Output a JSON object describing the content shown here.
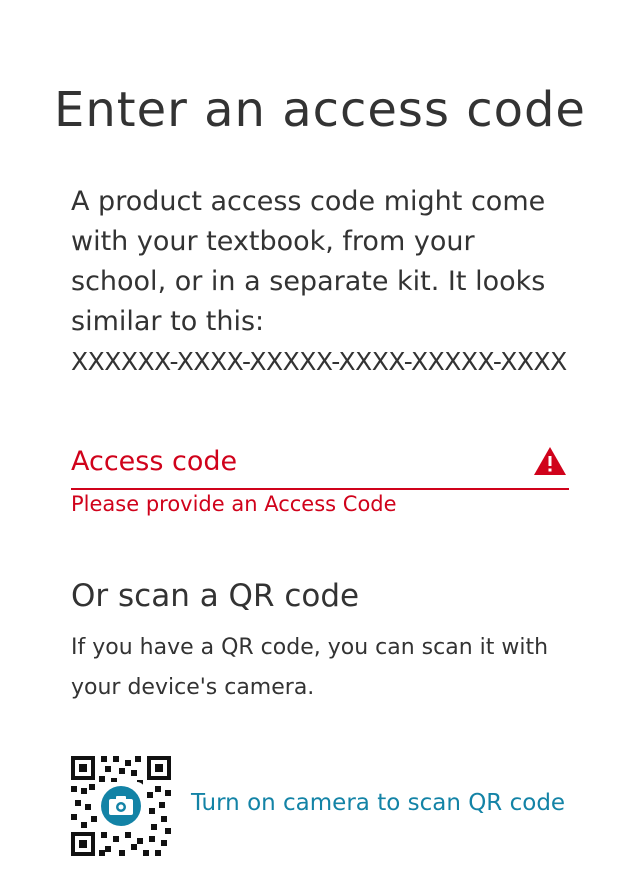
{
  "page": {
    "title": "Enter an access code",
    "intro": "A product access code might come with your textbook, from your school, or in a separate kit. It looks similar to this:",
    "code_example": "XXXXXX-XXXX-XXXXX-XXXX-XXXXX-XXXX"
  },
  "access_field": {
    "label": "Access code",
    "value": "",
    "error": "Please provide an Access Code",
    "error_color": "#d0021b",
    "status_icon": "warning-triangle-icon"
  },
  "qr_section": {
    "heading": "Or scan a QR code",
    "description": "If you have a QR code, you can scan it with your device's camera.",
    "camera_link": "Turn on camera to scan QR code",
    "link_color": "#1383a6",
    "icon": "qr-camera-icon"
  }
}
